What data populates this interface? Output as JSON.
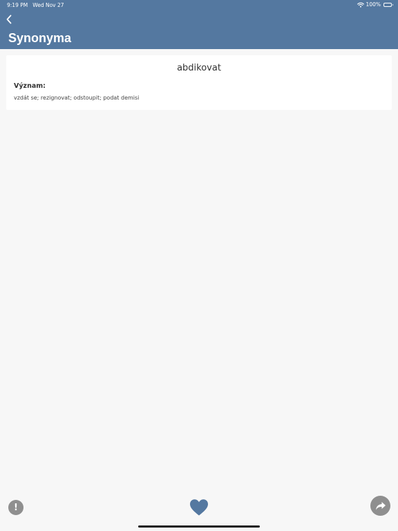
{
  "status_bar": {
    "time": "9:19 PM",
    "date": "Wed Nov 27",
    "battery": "100%",
    "battery_level": 1.0
  },
  "header": {
    "title": "Synonyma",
    "back_icon": "chevron-left-icon"
  },
  "entry": {
    "word": "abdikovat",
    "meaning_label": "Význam:",
    "meaning_text": "vzdát se; rezignovat; odstoupit; podat demisi"
  },
  "toolbar": {
    "report_glyph": "!",
    "report_icon": "exclamation-icon",
    "favorite_icon": "heart-icon",
    "share_icon": "share-arrow-icon"
  },
  "colors": {
    "accent": "#5478a0",
    "background": "#f7f7f7",
    "card": "#ffffff",
    "button_gray": "#8f8f8f"
  }
}
